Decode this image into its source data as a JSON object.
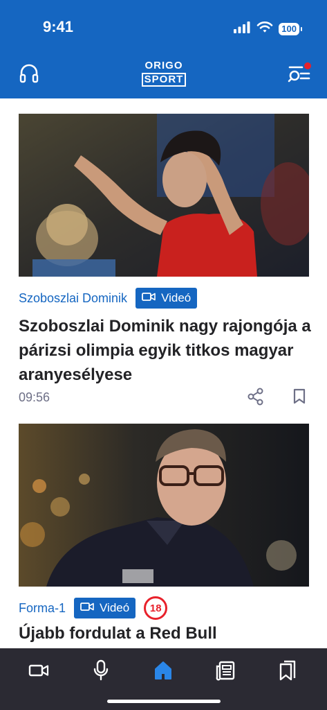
{
  "status_bar": {
    "time": "9:41",
    "battery": "100"
  },
  "header": {
    "logo_top": "ORIGO",
    "logo_bottom": "SPORT",
    "left_icon": "headphones-icon",
    "right_icon": "menu-notification-icon",
    "has_notification": true
  },
  "articles": [
    {
      "category": "Szoboszlai Dominik",
      "badge": "Videó",
      "title": "Szoboszlai Dominik nagy rajongója a párizsi olimpia egyik titkos magyar aranyesélyese",
      "time": "09:56"
    },
    {
      "category": "Forma-1",
      "badge": "Videó",
      "age_rating": "18",
      "title": "Újabb fordulat a Red Bull"
    }
  ],
  "bottom_nav": {
    "items": [
      {
        "icon": "video-icon",
        "active": false
      },
      {
        "icon": "microphone-icon",
        "active": false
      },
      {
        "icon": "home-icon",
        "active": true
      },
      {
        "icon": "newspaper-icon",
        "active": false
      },
      {
        "icon": "bookmarks-icon",
        "active": false
      }
    ]
  },
  "colors": {
    "brand_blue": "#1566c1",
    "nav_bg": "#2b2a33",
    "alert_red": "#e8212b",
    "active_icon": "#2a86e8"
  }
}
